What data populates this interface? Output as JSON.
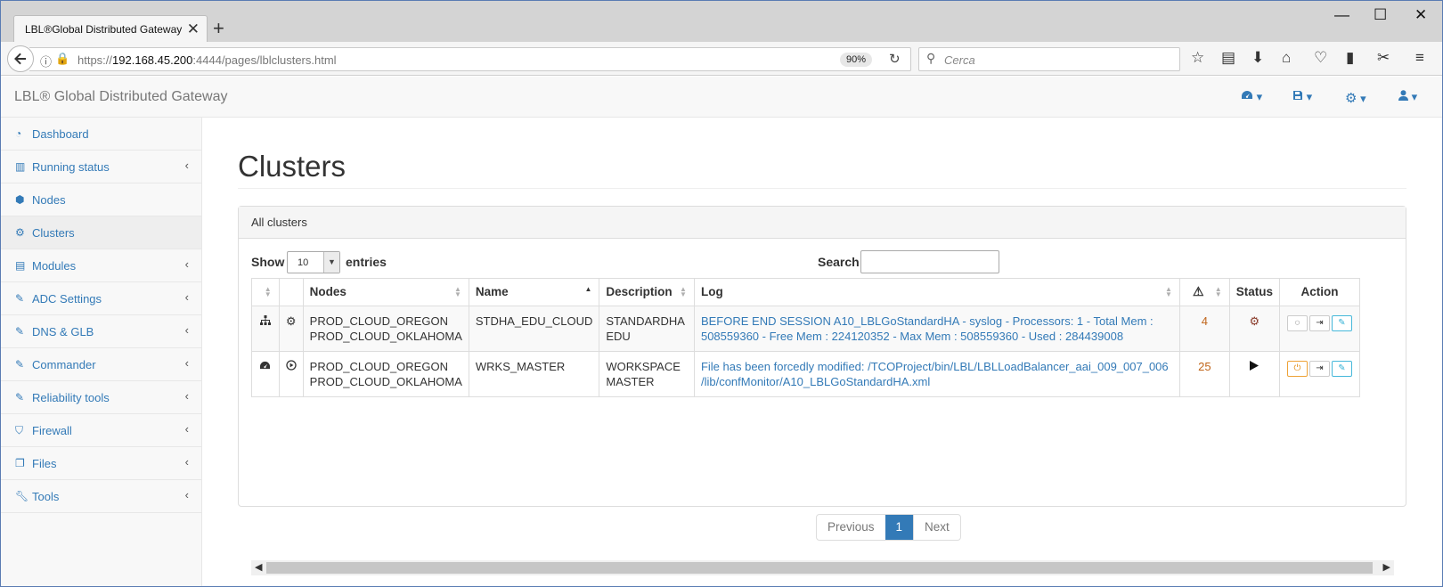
{
  "browser": {
    "tab_title": "LBL®Global Distributed Gateway",
    "tab_close": "✕",
    "new_tab": "+",
    "url_plain_start": "https://",
    "url_host": "192.168.45.200",
    "url_plain_end": ":4444/pages/lblclusters.html",
    "zoom": "90%",
    "search_placeholder": "Cerca"
  },
  "app": {
    "brand": "LBL® Global Distributed Gateway",
    "header_menus": [
      "dashboard-menu",
      "save-menu",
      "settings-menu",
      "user-menu"
    ]
  },
  "sidebar": {
    "items": [
      {
        "label": "Dashboard",
        "icon": "dashboard-icon",
        "has_submenu": false
      },
      {
        "label": "Running status",
        "icon": "bar-chart-icon",
        "has_submenu": true
      },
      {
        "label": "Nodes",
        "icon": "cube-icon",
        "has_submenu": false
      },
      {
        "label": "Clusters",
        "icon": "cogs-icon",
        "has_submenu": false,
        "active": true
      },
      {
        "label": "Modules",
        "icon": "list-icon",
        "has_submenu": true
      },
      {
        "label": "ADC Settings",
        "icon": "edit-icon",
        "has_submenu": true
      },
      {
        "label": "DNS & GLB",
        "icon": "edit-icon",
        "has_submenu": true
      },
      {
        "label": "Commander",
        "icon": "edit-icon",
        "has_submenu": true
      },
      {
        "label": "Reliability tools",
        "icon": "edit-icon",
        "has_submenu": true
      },
      {
        "label": "Firewall",
        "icon": "shield-icon",
        "has_submenu": true
      },
      {
        "label": "Files",
        "icon": "files-icon",
        "has_submenu": true
      },
      {
        "label": "Tools",
        "icon": "wrench-icon",
        "has_submenu": true
      }
    ]
  },
  "main": {
    "title": "Clusters",
    "panel_heading": "All clusters",
    "show_label": "Show",
    "entries_value": "10",
    "entries_label": "entries",
    "search_label": "Search:",
    "search_value": "",
    "columns": [
      "",
      "",
      "Nodes",
      "Name",
      "Description",
      "Log",
      "",
      "Status",
      "Action"
    ],
    "rows": [
      {
        "type_icon": "sitemap-icon",
        "mode_icon": "gear-icon",
        "nodes": [
          "PROD_CLOUD_OREGON",
          "PROD_CLOUD_OKLAHOMA"
        ],
        "name": "STDHA_EDU_CLOUD",
        "description": [
          "STANDARDHA",
          "EDU"
        ],
        "log": "BEFORE END SESSION A10_LBLGoStandardHA - syslog - Processors: 1 - Total Mem : 508559360 - Free Mem : 224120352 - Max Mem : 508559360 - Used : 284439008",
        "count": "4",
        "status_icon": "gear-icon"
      },
      {
        "type_icon": "dashboard-icon",
        "mode_icon": "play-circle-icon",
        "nodes": [
          "PROD_CLOUD_OREGON",
          "PROD_CLOUD_OKLAHOMA"
        ],
        "name": "WRKS_MASTER",
        "description": [
          "WORKSPACE",
          "MASTER"
        ],
        "log": "File has been forcedly modified: /TCOProject/bin/LBL/LBLLoadBalancer_aai_009_007_006 /lib/confMonitor/A10_LBLGoStandardHA.xml",
        "count": "25",
        "status_icon": "play-icon"
      }
    ],
    "pagination": {
      "previous": "Previous",
      "current": "1",
      "next": "Next"
    }
  }
}
